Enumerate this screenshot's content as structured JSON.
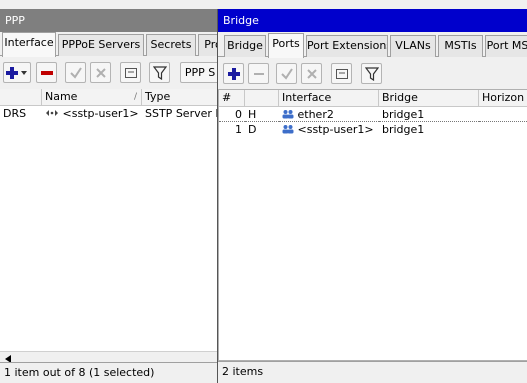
{
  "ppp": {
    "title": "PPP",
    "tabs": [
      "Interface",
      "PPPoE Servers",
      "Secrets",
      "Pro"
    ],
    "toolbar": {
      "ppp_scanner_label": "PPP S"
    },
    "columns": [
      "",
      "Name",
      "Type"
    ],
    "rows": [
      {
        "flag": "DRS",
        "name": "<sstp-user1>",
        "type": "SSTP Server B"
      }
    ],
    "status": "1 item out of 8 (1 selected)"
  },
  "bridge": {
    "title": "Bridge",
    "tabs": [
      "Bridge",
      "Ports",
      "Port Extensions",
      "VLANs",
      "MSTIs",
      "Port MS"
    ],
    "columns": [
      "#",
      "",
      "Interface",
      "Bridge",
      "Horizon"
    ],
    "rows": [
      {
        "num": "0",
        "flag": "H",
        "interface": "ether2",
        "bridge": "bridge1",
        "horizon": ""
      },
      {
        "num": "1",
        "flag": "D",
        "interface": "<sstp-user1>",
        "bridge": "bridge1",
        "horizon": ""
      }
    ],
    "status": "2 items"
  },
  "icons": [
    "add-icon",
    "remove-icon",
    "enable-icon",
    "disable-icon",
    "comment-icon",
    "filter-icon",
    "sort-icon",
    "scroll-left-icon",
    "interface-icon"
  ],
  "colors": {
    "bridge_titlebar": "#0000cc",
    "ppp_titlebar": "#7f7f7f",
    "add_blue": "#1a1aa0",
    "remove_red": "#c00000"
  }
}
